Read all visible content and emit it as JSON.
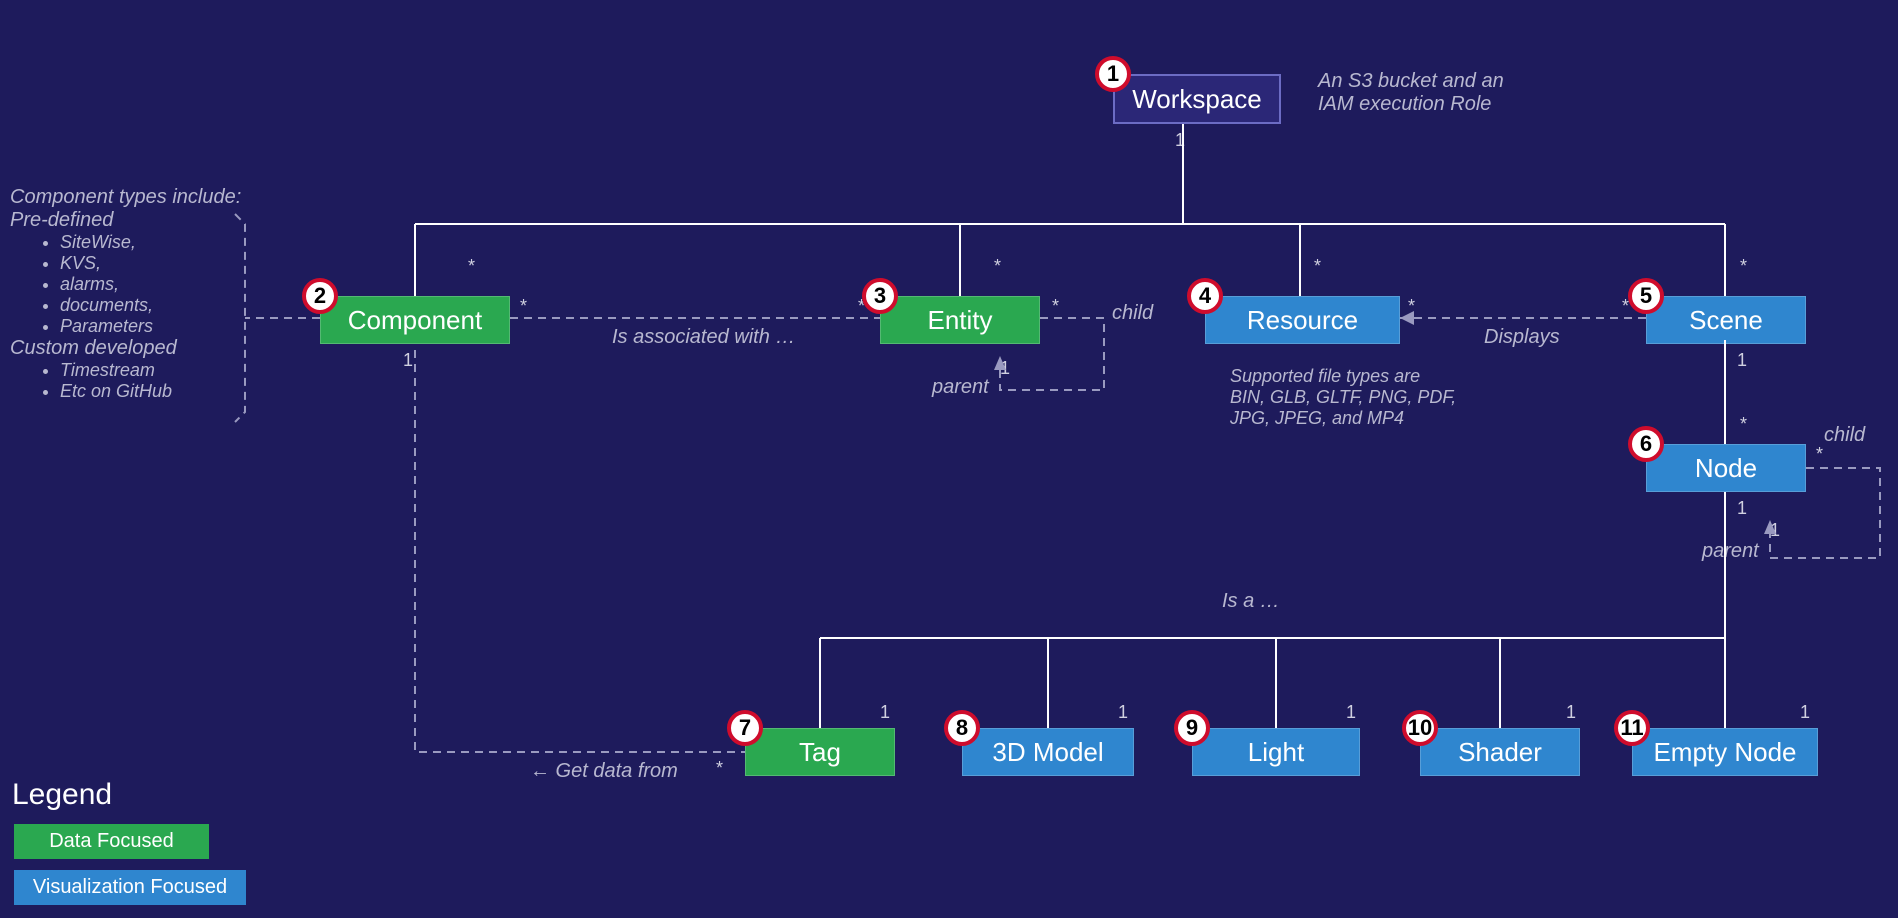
{
  "nodes": {
    "workspace": {
      "num": "1",
      "label": "Workspace"
    },
    "component": {
      "num": "2",
      "label": "Component"
    },
    "entity": {
      "num": "3",
      "label": "Entity"
    },
    "resource": {
      "num": "4",
      "label": "Resource"
    },
    "scene": {
      "num": "5",
      "label": "Scene"
    },
    "node_n": {
      "num": "6",
      "label": "Node"
    },
    "tag": {
      "num": "7",
      "label": "Tag"
    },
    "model3d": {
      "num": "8",
      "label": "3D Model"
    },
    "light": {
      "num": "9",
      "label": "Light"
    },
    "shader": {
      "num": "10",
      "label": "Shader"
    },
    "emptynode": {
      "num": "11",
      "label": "Empty Node"
    }
  },
  "ann": {
    "workspace_hint_l1": "An S3 bucket and an",
    "workspace_hint_l2": "IAM execution Role",
    "resource_hint_l1": "Supported file types are",
    "resource_hint_l2": "BIN, GLB, GLTF, PNG, PDF,",
    "resource_hint_l3": "JPG, JPEG, and MP4",
    "component_head": "Component types include:",
    "component_pre": "Pre-defined",
    "component_predef": [
      "SiteWise,",
      "KVS,",
      "alarms,",
      "documents,",
      "Parameters"
    ],
    "component_custom_head": "Custom developed",
    "component_custom": [
      "Timestream",
      "Etc on GitHub"
    ]
  },
  "labels": {
    "assoc": "Is associated with …",
    "displays": "Displays",
    "isa": "Is a …",
    "getdata": "← Get data from",
    "child": "child",
    "parent": "parent"
  },
  "card": {
    "one": "1",
    "many": "*"
  },
  "legend": {
    "title": "Legend",
    "data": "Data Focused",
    "viz": "Visualization Focused"
  }
}
